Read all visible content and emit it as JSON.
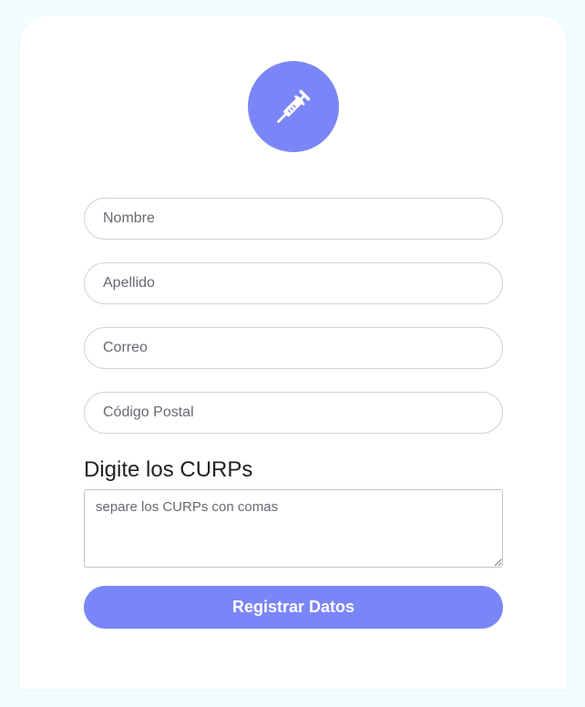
{
  "form": {
    "icon": "syringe-icon",
    "fields": [
      {
        "placeholder": "Nombre",
        "value": ""
      },
      {
        "placeholder": "Apellido",
        "value": ""
      },
      {
        "placeholder": "Correo",
        "value": ""
      },
      {
        "placeholder": "Código Postal",
        "value": ""
      }
    ],
    "curp_label": "Digite los CURPs",
    "curp_placeholder": "separe los CURPs con comas",
    "curp_value": "",
    "submit_label": "Registrar Datos"
  },
  "colors": {
    "accent": "#7a86f7",
    "page_background": "#f2fdfe",
    "card_background": "#ffffff"
  }
}
